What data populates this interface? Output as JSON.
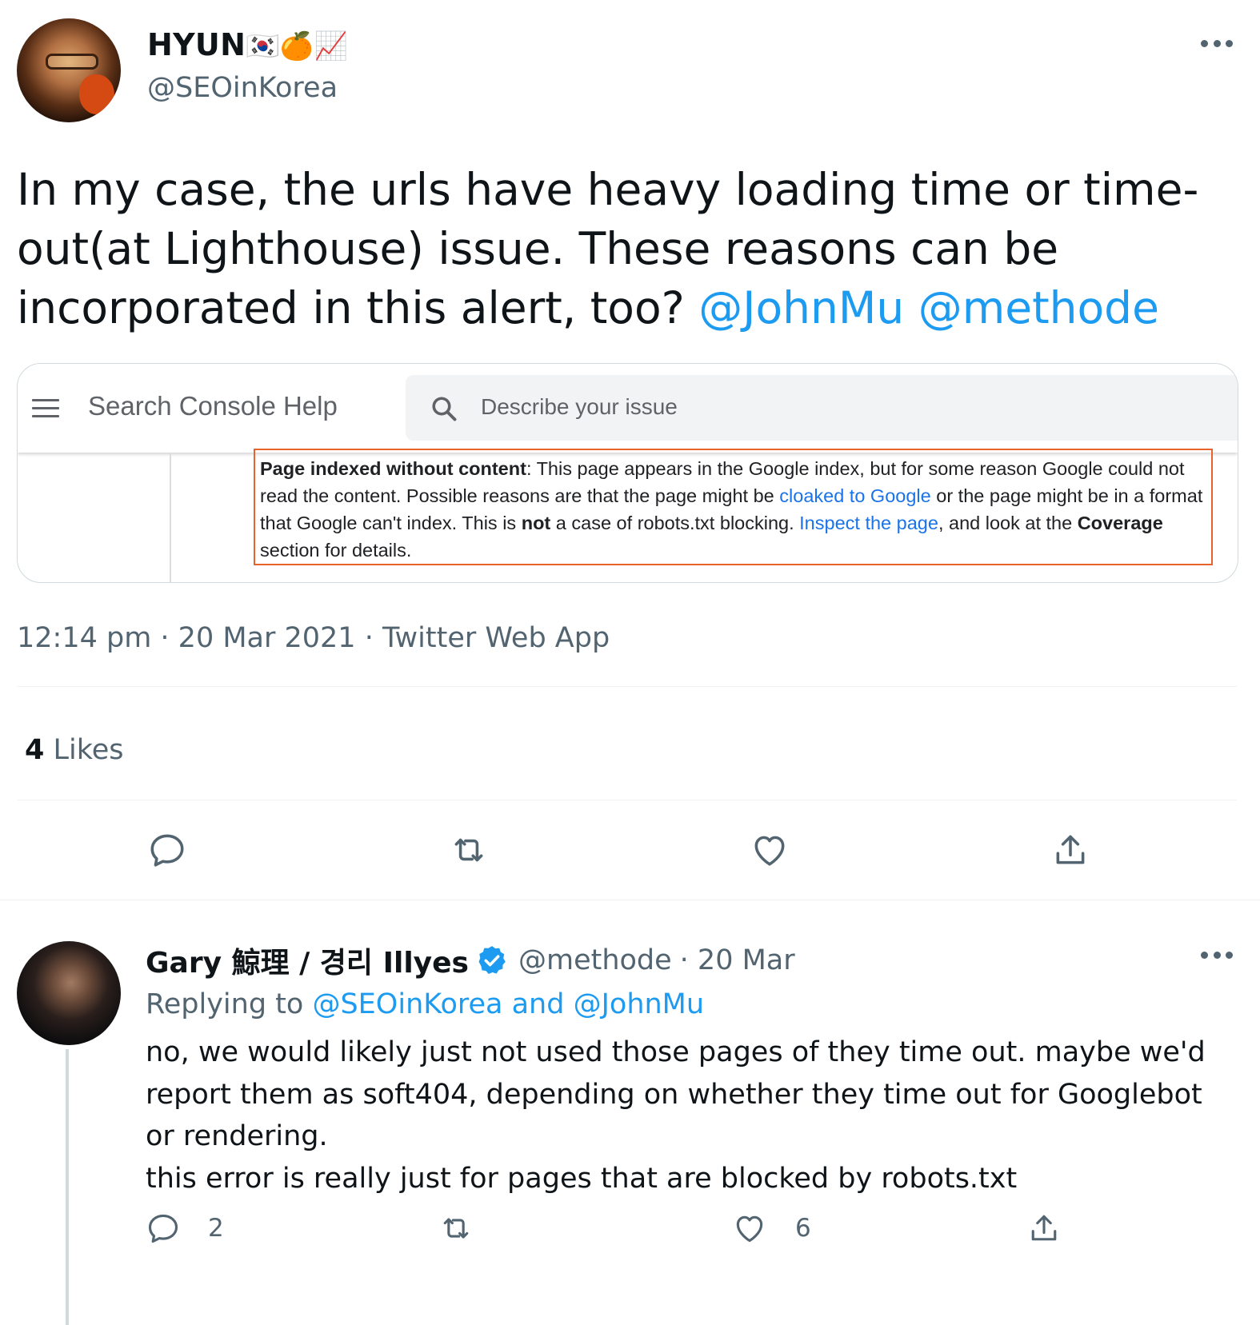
{
  "tweet": {
    "author_name": "HYUN",
    "author_emojis": "🇰🇷🍊📈",
    "author_handle": "@SEOinKorea",
    "text_main": "In my case, the urls have heavy loading time or time-out(at Lighthouse) issue. These reasons can be incorporated in this alert, too?",
    "mention_1": "@JohnMu",
    "mention_2": "@methode",
    "timestamp": "12:14 pm · 20 Mar 2021 · Twitter Web App",
    "likes_count": "4",
    "likes_label": "Likes"
  },
  "card": {
    "title": "Search Console Help",
    "search_placeholder": "Describe your issue",
    "alert_bold_title": "Page indexed without content",
    "alert_text_1": ": This page appears in the Google index, but for some reason Google could not read the content. Possible reasons are that the page might be ",
    "alert_link_1": "cloaked to Google",
    "alert_text_2": " or the page might be in a format that Google can't index. This is ",
    "alert_bold_not": "not",
    "alert_text_3": " a case of robots.txt blocking. ",
    "alert_link_2": "Inspect the page",
    "alert_text_4": ", and look at the ",
    "alert_bold_coverage": "Coverage",
    "alert_text_5": " section for details."
  },
  "reply": {
    "author_name": "Gary 鯨理 / 경리 Illyes",
    "author_handle": "@methode",
    "date": "· 20 Mar",
    "replying_prefix": "Replying to",
    "replying_targets": "@SEOinKorea and @JohnMu",
    "text_line_1": "no, we would likely just not used those pages of they time out. maybe we'd report them as soft404, depending on whether they time out for Googlebot or rendering.",
    "text_line_2": "this error is really just for pages that are blocked by robots.txt",
    "reply_count": "2",
    "like_count": "6"
  },
  "icons": {
    "reply": "reply-icon",
    "retweet": "retweet-icon",
    "like": "like-icon",
    "share": "share-icon",
    "more": "more-icon",
    "verified": "verified-badge-icon",
    "menu": "menu-icon",
    "search": "search-icon"
  },
  "colors": {
    "link_blue": "#1d9bf0",
    "secondary_text": "#536471",
    "alert_border": "#e8622c",
    "google_link": "#1a73e8"
  }
}
